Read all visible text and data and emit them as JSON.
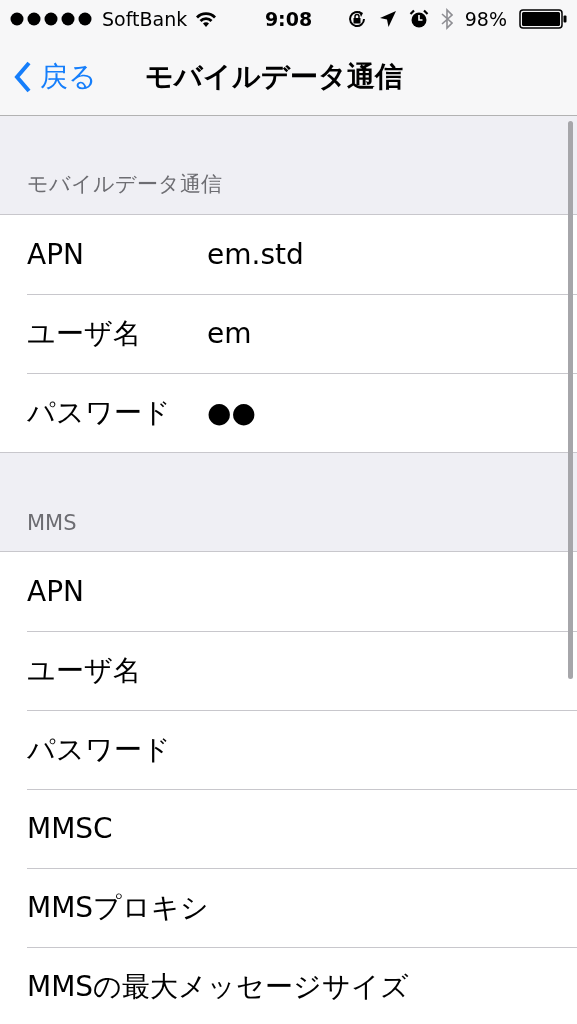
{
  "status_bar": {
    "carrier": "SoftBank",
    "time": "9:08",
    "battery": "98%"
  },
  "nav_bar": {
    "back": "戻る",
    "title": "モバイルデータ通信"
  },
  "sections": [
    {
      "header": "モバイルデータ通信",
      "rows": [
        {
          "label": "APN",
          "value": "em.std"
        },
        {
          "label": "ユーザ名",
          "value": "em"
        },
        {
          "label": "パスワード",
          "value": "●●"
        }
      ]
    },
    {
      "header": "MMS",
      "rows": [
        {
          "label": "APN"
        },
        {
          "label": "ユーザ名"
        },
        {
          "label": "パスワード"
        },
        {
          "label": "MMSC"
        },
        {
          "label": "MMSプロキシ"
        },
        {
          "label": "MMSの最大メッセージサイズ"
        }
      ]
    }
  ]
}
